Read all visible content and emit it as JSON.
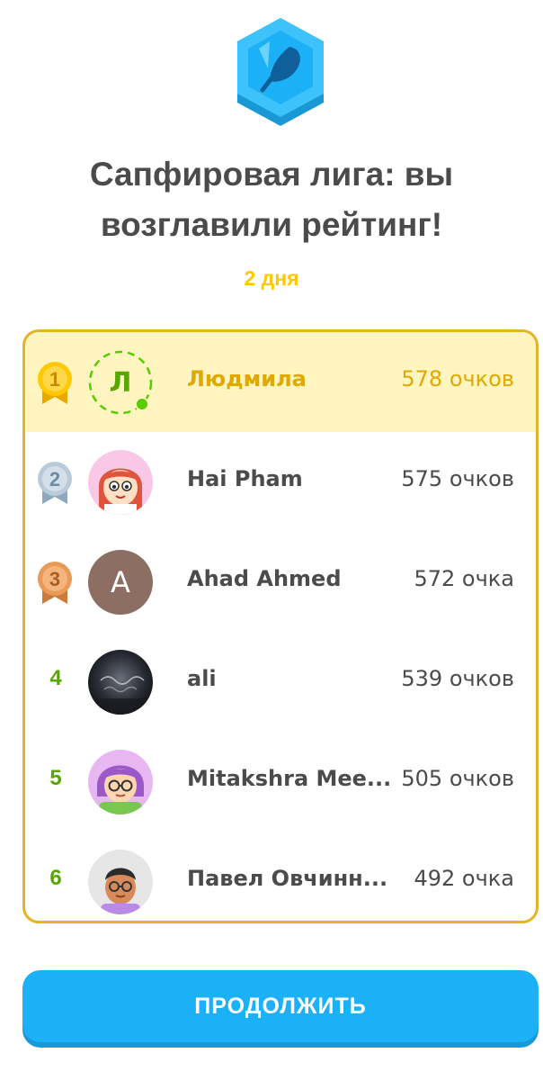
{
  "header": {
    "league_icon": "feather-icon",
    "title": "Сапфировая лига: вы возглавили рейтинг!",
    "days_left": "2 дня"
  },
  "leaderboard": [
    {
      "rank": "1",
      "name": "Людмила",
      "points": "578 очков",
      "avatar_letter": "Л",
      "is_current_user": true,
      "medal": "gold"
    },
    {
      "rank": "2",
      "name": "Hai Pham",
      "points": "575 очков",
      "medal": "silver"
    },
    {
      "rank": "3",
      "name": "Ahad Ahmed",
      "points": "572 очка",
      "avatar_letter": "A",
      "medal": "bronze"
    },
    {
      "rank": "4",
      "name": "ali",
      "points": "539 очков"
    },
    {
      "rank": "5",
      "name": "Mitakshra Mee...",
      "points": "505 очков"
    },
    {
      "rank": "6",
      "name": "Павел Овчинн...",
      "points": "492 очка"
    }
  ],
  "actions": {
    "continue_label": "ПРОДОЛЖИТЬ"
  },
  "colors": {
    "accent": "#1cb0f6",
    "gold": "#ffc800",
    "highlight_row": "#fff5c0",
    "board_border": "#e5b423",
    "rank_green": "#58a700"
  }
}
